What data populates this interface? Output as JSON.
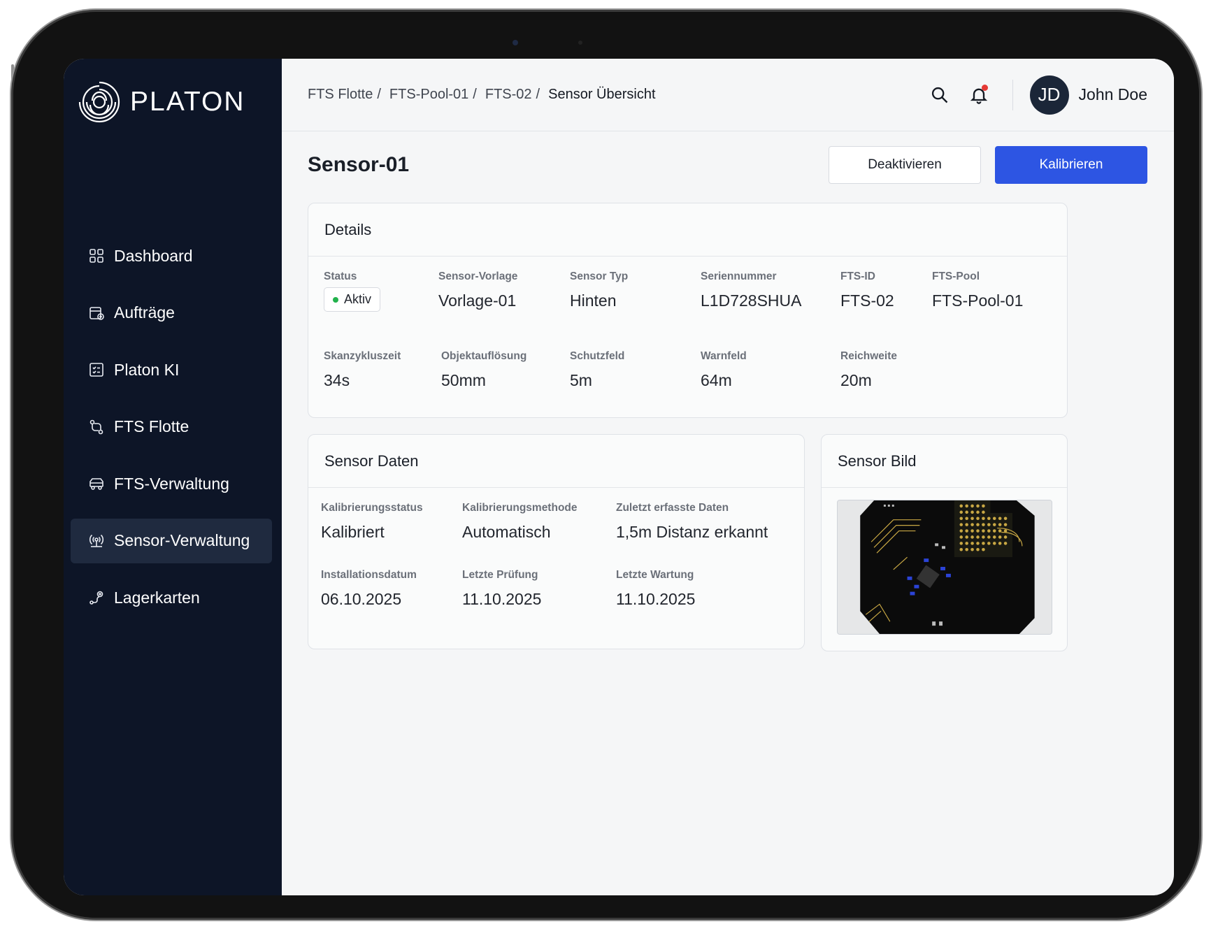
{
  "brand": {
    "name": "PLATON"
  },
  "sidebar": {
    "items": [
      {
        "label": "Dashboard",
        "icon": "dashboard-grid-icon",
        "active": false
      },
      {
        "label": "Aufträge",
        "icon": "orders-icon",
        "active": false
      },
      {
        "label": "Platon KI",
        "icon": "ai-checklist-icon",
        "active": false
      },
      {
        "label": "FTS Flotte",
        "icon": "route-icon",
        "active": false
      },
      {
        "label": "FTS-Verwaltung",
        "icon": "vehicle-icon",
        "active": false
      },
      {
        "label": "Sensor-Verwaltung",
        "icon": "sensor-signal-icon",
        "active": true
      },
      {
        "label": "Lagerkarten",
        "icon": "map-pin-route-icon",
        "active": false
      }
    ]
  },
  "header": {
    "breadcrumb": [
      "FTS Flotte",
      "FTS-Pool-01",
      "FTS-02",
      "Sensor Übersicht"
    ],
    "breadcrumb_separator": "/",
    "user": {
      "initials": "JD",
      "name": "John Doe"
    },
    "notification_dot_color": "#e53935"
  },
  "page": {
    "title": "Sensor-01",
    "deactivate_label": "Deaktivieren",
    "calibrate_label": "Kalibrieren",
    "primary_color": "#2d55e3"
  },
  "details": {
    "title": "Details",
    "status_label": "Status",
    "status_value": "Aktiv",
    "status_color": "#22b24c",
    "row1": [
      {
        "label": "Sensor-Vorlage",
        "value": "Vorlage-01"
      },
      {
        "label": "Sensor Typ",
        "value": "Hinten"
      },
      {
        "label": "Seriennummer",
        "value": "L1D728SHUA"
      },
      {
        "label": "FTS-ID",
        "value": "FTS-02"
      },
      {
        "label": "FTS-Pool",
        "value": "FTS-Pool-01"
      }
    ],
    "row2": [
      {
        "label": "Skanzykluszeit",
        "value": "34s"
      },
      {
        "label": "Objektauflösung",
        "value": "50mm"
      },
      {
        "label": "Schutzfeld",
        "value": "5m"
      },
      {
        "label": "Warnfeld",
        "value": "64m"
      },
      {
        "label": "Reichweite",
        "value": "20m"
      }
    ]
  },
  "sensor_data": {
    "title": "Sensor Daten",
    "fields": [
      {
        "label": "Kalibrierungsstatus",
        "value": "Kalibriert"
      },
      {
        "label": "Kalibrierungsmethode",
        "value": "Automatisch"
      },
      {
        "label": "Zuletzt erfasste Daten",
        "value": "1,5m Distanz erkannt"
      },
      {
        "label": "Installationsdatum",
        "value": "06.10.2025"
      },
      {
        "label": "Letzte Prüfung",
        "value": "11.10.2025"
      },
      {
        "label": "Letzte Wartung",
        "value": "11.10.2025"
      }
    ]
  },
  "sensor_image": {
    "title": "Sensor Bild"
  }
}
